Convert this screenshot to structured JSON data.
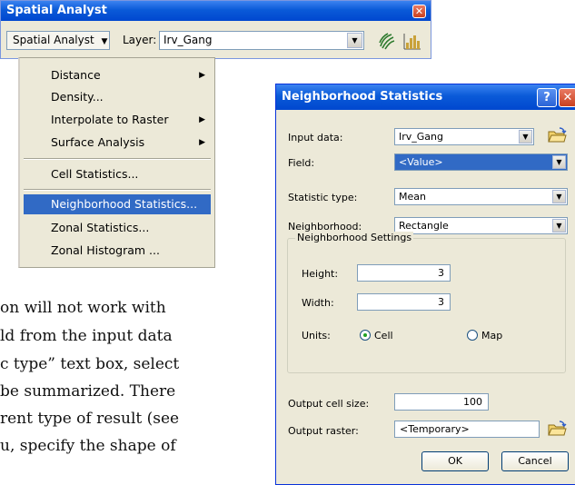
{
  "toolbar": {
    "title": "Spatial Analyst",
    "menu_label": "Spatial Analyst",
    "layer_label": "Layer:",
    "layer_value": "Irv_Gang"
  },
  "menu": {
    "items": [
      {
        "label": "Distance",
        "submenu": true
      },
      {
        "label": "Density...",
        "submenu": false
      },
      {
        "label": "Interpolate to Raster",
        "submenu": true
      },
      {
        "label": "Surface Analysis",
        "submenu": true
      },
      {
        "label": "Cell Statistics...",
        "submenu": false
      },
      {
        "label": "Neighborhood Statistics...",
        "submenu": false,
        "selected": true
      },
      {
        "label": "Zonal Statistics...",
        "submenu": false
      },
      {
        "label": "Zonal Histogram ...",
        "submenu": false
      }
    ]
  },
  "body_text": [
    "on will not work with",
    "ld from the input data",
    "c type” text box, select",
    "be summarized. There",
    "rent type of result (see",
    "u, specify the shape of"
  ],
  "dialog": {
    "title": "Neighborhood Statistics",
    "input_data_label": "Input data:",
    "input_data_value": "Irv_Gang",
    "field_label": "Field:",
    "field_value": "<Value>",
    "statistic_label": "Statistic type:",
    "statistic_value": "Mean",
    "neighborhood_label": "Neighborhood:",
    "neighborhood_value": "Rectangle",
    "group_title": "Neighborhood Settings",
    "height_label": "Height:",
    "height_value": "3",
    "width_label": "Width:",
    "width_value": "3",
    "units_label": "Units:",
    "unit_cell": "Cell",
    "unit_map": "Map",
    "units_selected": "Cell",
    "cell_size_label": "Output cell size:",
    "cell_size_value": "100",
    "output_raster_label": "Output raster:",
    "output_raster_value": "<Temporary>",
    "ok_label": "OK",
    "cancel_label": "Cancel"
  },
  "colors": {
    "title_bar": "#0a5ad8",
    "selection": "#316ac5",
    "window_face": "#ece9d8"
  }
}
